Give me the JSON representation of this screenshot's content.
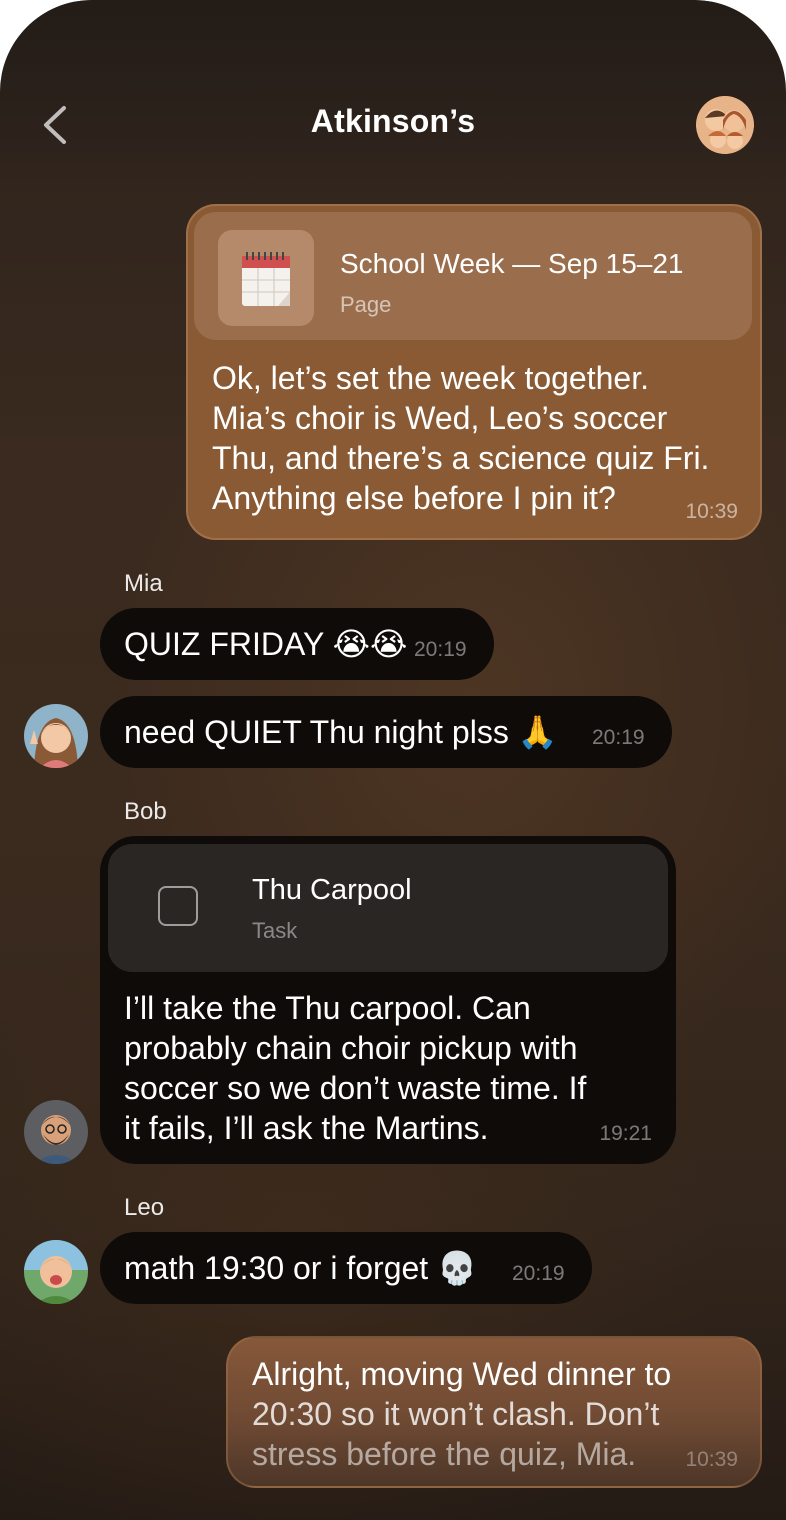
{
  "header": {
    "title": "Atkinson’s",
    "back_icon": "chevron-left-icon",
    "group_avatar_icon": "family-avatar"
  },
  "messages": [
    {
      "attachment": {
        "icon": "calendar-icon",
        "title": "School Week — Sep 15–21",
        "type": "Page"
      },
      "lines": [
        "Ok, let’s set the week together.",
        "Mia’s choir is Wed, Leo’s soccer",
        "Thu, and there’s a science quiz Fri.",
        "Anything else before I pin it?"
      ],
      "time": "10:39"
    },
    {
      "sender": "Mia",
      "text": "QUIZ FRIDAY 😭😭",
      "time": "20:19"
    },
    {
      "text": "need QUIET Thu night plss 🙏",
      "time": "20:19"
    },
    {
      "sender": "Bob",
      "task": {
        "title": "Thu Carpool",
        "type": "Task"
      },
      "lines": [
        "I’ll take the Thu carpool. Can",
        "probably chain choir pickup with",
        "soccer so we don’t waste time. If",
        "it fails, I’ll ask the Martins."
      ],
      "time": "19:21"
    },
    {
      "sender": "Leo",
      "text": "math 19:30 or i forget 💀",
      "time": "20:19"
    },
    {
      "lines": [
        "Alright, moving Wed dinner to",
        "20:30 so it won’t clash. Don’t",
        "stress before the quiz, Mia."
      ],
      "time": "10:39"
    }
  ],
  "colors": {
    "outgoing_bubble": "#8a5a34",
    "incoming_bubble": "#0f0b09",
    "background": "#3a2a1f"
  }
}
